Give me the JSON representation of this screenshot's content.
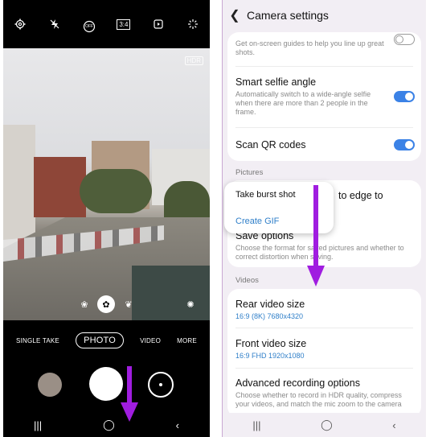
{
  "camera": {
    "top_icons": [
      "settings-icon",
      "flash-off-icon",
      "timer-off-icon",
      "aspect-ratio-icon",
      "motion-photo-icon",
      "sparkle-filter-icon"
    ],
    "timer_label": "OFF",
    "ratio_label": "3:4",
    "hdr_label": "HDR",
    "modes": [
      "SINGLE TAKE",
      "PHOTO",
      "VIDEO",
      "MORE"
    ],
    "active_mode": "PHOTO",
    "nav": [
      "|||",
      "◯",
      "‹"
    ]
  },
  "settings": {
    "title": "Camera settings",
    "top_desc": "Get on-screen guides to help you line up great shots.",
    "smart_selfie": {
      "title": "Smart selfie angle",
      "desc": "Automatically switch to a wide-angle selfie when there are more than 2 people in the frame."
    },
    "scan_qr": {
      "title": "Scan QR codes"
    },
    "section_pictures": "Pictures",
    "swipe_row_tail": "to edge to",
    "popup": {
      "item1": "Take burst shot",
      "item2": "Create GIF"
    },
    "save_options": {
      "title": "Save options",
      "desc": "Choose the format for saved pictures and whether to correct distortion when saving."
    },
    "section_videos": "Videos",
    "rear_video": {
      "title": "Rear video size",
      "value": "16:9 (8K) 7680x4320"
    },
    "front_video": {
      "title": "Front video size",
      "value": "16:9 FHD 1920x1080"
    },
    "advanced": {
      "title": "Advanced recording options",
      "desc": "Choose whether to record in HDR quality, compress your videos, and match the mic zoom to the camera"
    },
    "nav": [
      "|||",
      "◯",
      "‹"
    ]
  },
  "colors": {
    "accent_blue": "#3b82e6",
    "arrow_purple": "#a01de0",
    "link_blue": "#2f7fc9"
  }
}
